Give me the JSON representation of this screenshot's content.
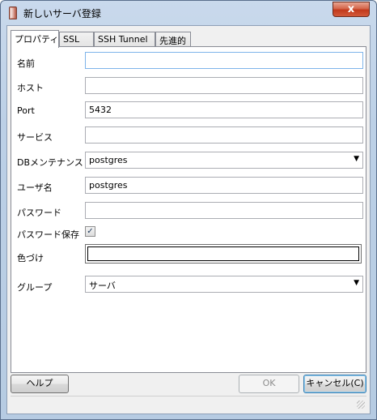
{
  "window": {
    "title": "新しいサーバ登録",
    "close_glyph": "x"
  },
  "tabs": [
    {
      "label": "プロパティ",
      "active": true
    },
    {
      "label": "SSL",
      "active": false
    },
    {
      "label": "SSH Tunnel",
      "active": false
    },
    {
      "label": "先進的",
      "active": false
    }
  ],
  "form": {
    "name": {
      "label": "名前",
      "value": ""
    },
    "host": {
      "label": "ホスト",
      "value": ""
    },
    "port": {
      "label": "Port",
      "value": "5432"
    },
    "service": {
      "label": "サービス",
      "value": ""
    },
    "maintenance_db": {
      "label": "DBメンテナンス",
      "value": "postgres"
    },
    "username": {
      "label": "ユーザ名",
      "value": "postgres"
    },
    "password": {
      "label": "パスワード",
      "value": ""
    },
    "save_password": {
      "label": "パスワード保存",
      "checked": true,
      "check_glyph": "✓"
    },
    "colour": {
      "label": "色づけ",
      "value": "#ffffff"
    },
    "group": {
      "label": "グループ",
      "value": "サーバ"
    }
  },
  "buttons": {
    "help": "ヘルプ",
    "ok": "OK",
    "cancel": "キャンセル(C)"
  },
  "colors": {
    "titlebar": "#bcd0e6",
    "close_button": "#c2391c",
    "focus_border": "#7eb4ea"
  }
}
